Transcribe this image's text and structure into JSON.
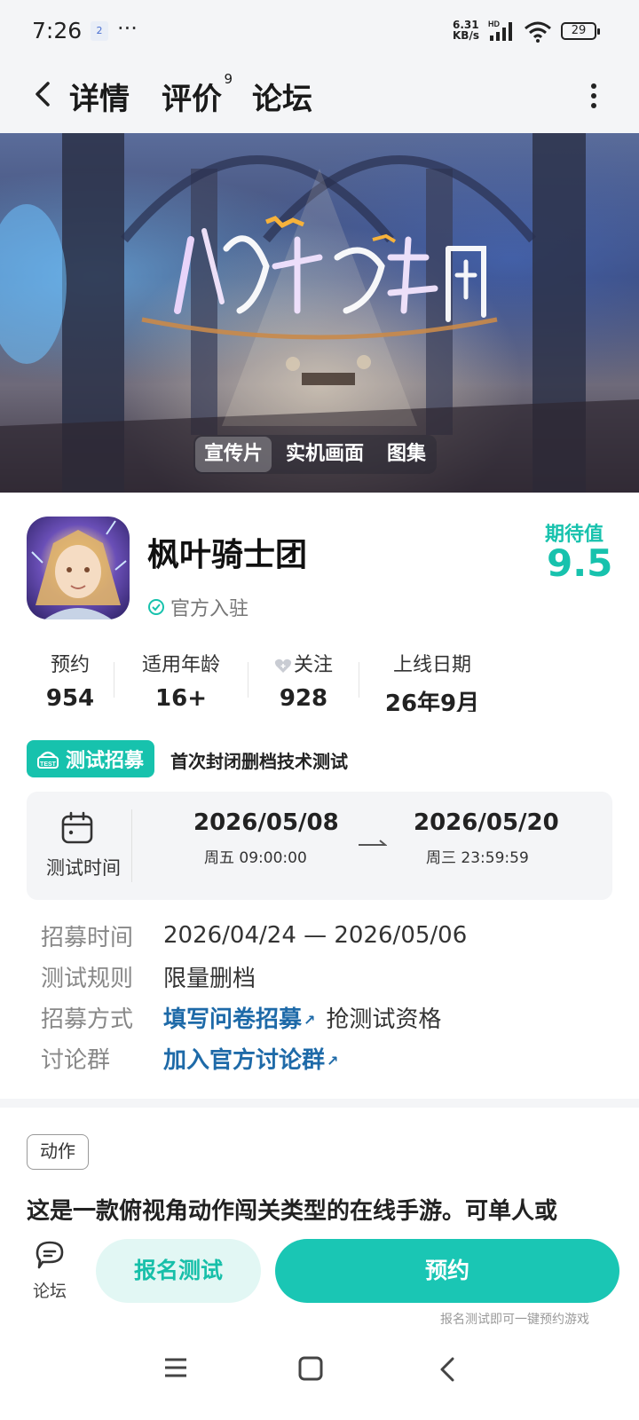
{
  "status_bar": {
    "time": "7:26",
    "notification_badge": "2",
    "more_dots": "···",
    "net_speed_value": "6.31",
    "net_speed_unit": "KB/s",
    "network_type": "HD",
    "battery": "29"
  },
  "navbar": {
    "tabs": [
      {
        "label": "详情",
        "active": true
      },
      {
        "label": "评价",
        "badge": "9"
      },
      {
        "label": "论坛"
      }
    ]
  },
  "banner": {
    "media_tabs": [
      "宣传片",
      "实机画面",
      "图集"
    ],
    "active_media_tab": "宣传片"
  },
  "game": {
    "title": "枫叶骑士团",
    "official_label": "官方入驻",
    "expect_label": "期待值",
    "expect_value": "9.5"
  },
  "stats": [
    {
      "label": "预约",
      "value": "954"
    },
    {
      "label": "适用年龄",
      "value": "16+"
    },
    {
      "label": "关注",
      "value": "928",
      "icon": "heart-icon"
    },
    {
      "label": "上线日期",
      "value": "26年9月"
    }
  ],
  "recruit": {
    "badge_label": "测试招募",
    "description": "首次封闭删档技术测试"
  },
  "test_period": {
    "label": "测试时间",
    "start_date": "2026/05/08",
    "start_day": "周五  09:00:00",
    "end_date": "2026/05/20",
    "end_day": "周三  23:59:59"
  },
  "info": {
    "recruit_time_key": "招募时间",
    "recruit_time_value": "2026/04/24 — 2026/05/06",
    "rules_key": "测试规则",
    "rules_value": "限量删档",
    "method_key": "招募方式",
    "method_link": "填写问卷招募",
    "method_extra": "抢测试资格",
    "group_key": "讨论群",
    "group_link": "加入官方讨论群"
  },
  "genre_tag": "动作",
  "description": "这是一款俯视角动作闯关类型的在线手游。可单人或",
  "bottom": {
    "forum_label": "论坛",
    "signup_label": "报名测试",
    "reserve_label": "预约",
    "hint": "报名测试即可一键预约游戏"
  },
  "colors": {
    "accent": "#17c2ad",
    "link": "#1e6aa8",
    "background": "#f4f5f7"
  }
}
